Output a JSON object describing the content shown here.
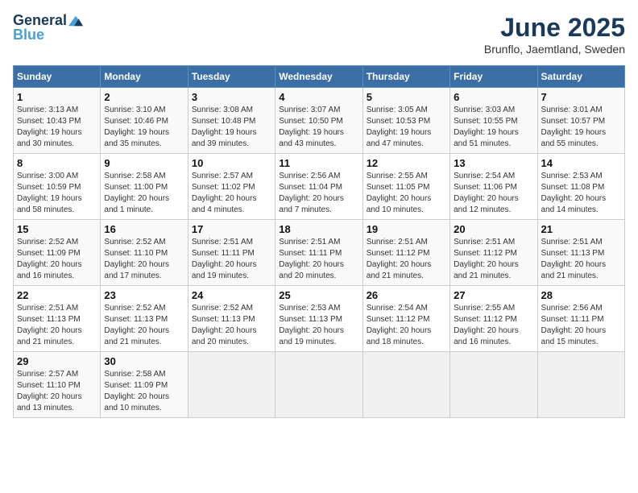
{
  "logo": {
    "general": "General",
    "blue": "Blue"
  },
  "title": "June 2025",
  "location": "Brunflo, Jaemtland, Sweden",
  "days_of_week": [
    "Sunday",
    "Monday",
    "Tuesday",
    "Wednesday",
    "Thursday",
    "Friday",
    "Saturday"
  ],
  "weeks": [
    [
      {
        "day": "1",
        "sunrise": "3:13 AM",
        "sunset": "10:43 PM",
        "daylight": "19 hours and 30 minutes."
      },
      {
        "day": "2",
        "sunrise": "3:10 AM",
        "sunset": "10:46 PM",
        "daylight": "19 hours and 35 minutes."
      },
      {
        "day": "3",
        "sunrise": "3:08 AM",
        "sunset": "10:48 PM",
        "daylight": "19 hours and 39 minutes."
      },
      {
        "day": "4",
        "sunrise": "3:07 AM",
        "sunset": "10:50 PM",
        "daylight": "19 hours and 43 minutes."
      },
      {
        "day": "5",
        "sunrise": "3:05 AM",
        "sunset": "10:53 PM",
        "daylight": "19 hours and 47 minutes."
      },
      {
        "day": "6",
        "sunrise": "3:03 AM",
        "sunset": "10:55 PM",
        "daylight": "19 hours and 51 minutes."
      },
      {
        "day": "7",
        "sunrise": "3:01 AM",
        "sunset": "10:57 PM",
        "daylight": "19 hours and 55 minutes."
      }
    ],
    [
      {
        "day": "8",
        "sunrise": "3:00 AM",
        "sunset": "10:59 PM",
        "daylight": "19 hours and 58 minutes."
      },
      {
        "day": "9",
        "sunrise": "2:58 AM",
        "sunset": "11:00 PM",
        "daylight": "20 hours and 1 minute."
      },
      {
        "day": "10",
        "sunrise": "2:57 AM",
        "sunset": "11:02 PM",
        "daylight": "20 hours and 4 minutes."
      },
      {
        "day": "11",
        "sunrise": "2:56 AM",
        "sunset": "11:04 PM",
        "daylight": "20 hours and 7 minutes."
      },
      {
        "day": "12",
        "sunrise": "2:55 AM",
        "sunset": "11:05 PM",
        "daylight": "20 hours and 10 minutes."
      },
      {
        "day": "13",
        "sunrise": "2:54 AM",
        "sunset": "11:06 PM",
        "daylight": "20 hours and 12 minutes."
      },
      {
        "day": "14",
        "sunrise": "2:53 AM",
        "sunset": "11:08 PM",
        "daylight": "20 hours and 14 minutes."
      }
    ],
    [
      {
        "day": "15",
        "sunrise": "2:52 AM",
        "sunset": "11:09 PM",
        "daylight": "20 hours and 16 minutes."
      },
      {
        "day": "16",
        "sunrise": "2:52 AM",
        "sunset": "11:10 PM",
        "daylight": "20 hours and 17 minutes."
      },
      {
        "day": "17",
        "sunrise": "2:51 AM",
        "sunset": "11:11 PM",
        "daylight": "20 hours and 19 minutes."
      },
      {
        "day": "18",
        "sunrise": "2:51 AM",
        "sunset": "11:11 PM",
        "daylight": "20 hours and 20 minutes."
      },
      {
        "day": "19",
        "sunrise": "2:51 AM",
        "sunset": "11:12 PM",
        "daylight": "20 hours and 21 minutes."
      },
      {
        "day": "20",
        "sunrise": "2:51 AM",
        "sunset": "11:12 PM",
        "daylight": "20 hours and 21 minutes."
      },
      {
        "day": "21",
        "sunrise": "2:51 AM",
        "sunset": "11:13 PM",
        "daylight": "20 hours and 21 minutes."
      }
    ],
    [
      {
        "day": "22",
        "sunrise": "2:51 AM",
        "sunset": "11:13 PM",
        "daylight": "20 hours and 21 minutes."
      },
      {
        "day": "23",
        "sunrise": "2:52 AM",
        "sunset": "11:13 PM",
        "daylight": "20 hours and 21 minutes."
      },
      {
        "day": "24",
        "sunrise": "2:52 AM",
        "sunset": "11:13 PM",
        "daylight": "20 hours and 20 minutes."
      },
      {
        "day": "25",
        "sunrise": "2:53 AM",
        "sunset": "11:13 PM",
        "daylight": "20 hours and 19 minutes."
      },
      {
        "day": "26",
        "sunrise": "2:54 AM",
        "sunset": "11:12 PM",
        "daylight": "20 hours and 18 minutes."
      },
      {
        "day": "27",
        "sunrise": "2:55 AM",
        "sunset": "11:12 PM",
        "daylight": "20 hours and 16 minutes."
      },
      {
        "day": "28",
        "sunrise": "2:56 AM",
        "sunset": "11:11 PM",
        "daylight": "20 hours and 15 minutes."
      }
    ],
    [
      {
        "day": "29",
        "sunrise": "2:57 AM",
        "sunset": "11:10 PM",
        "daylight": "20 hours and 13 minutes."
      },
      {
        "day": "30",
        "sunrise": "2:58 AM",
        "sunset": "11:09 PM",
        "daylight": "20 hours and 10 minutes."
      },
      null,
      null,
      null,
      null,
      null
    ]
  ],
  "labels": {
    "sunrise": "Sunrise:",
    "sunset": "Sunset:",
    "daylight": "Daylight:"
  }
}
